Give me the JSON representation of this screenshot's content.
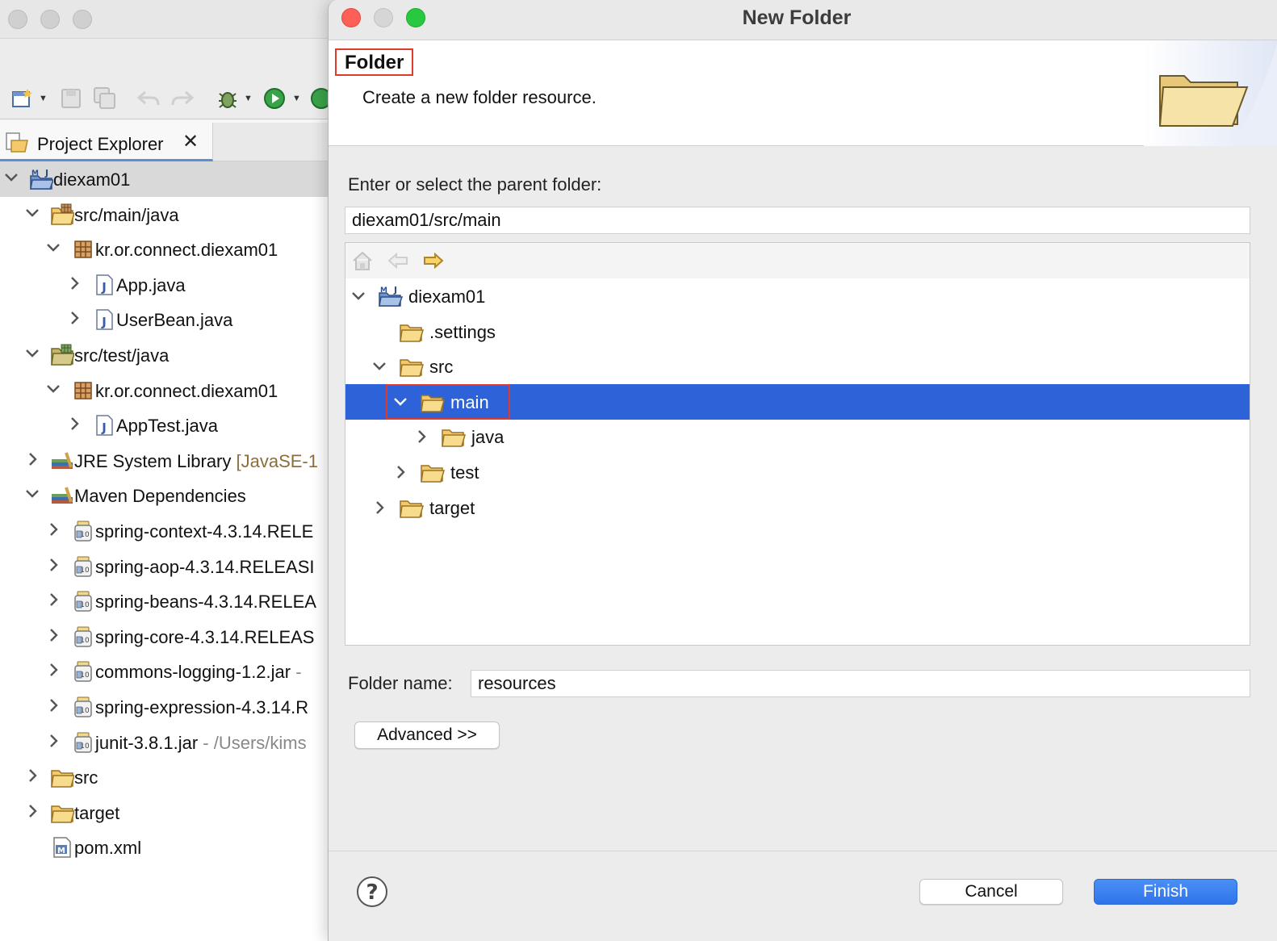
{
  "explorer": {
    "tab_label": "Project Explorer",
    "items": [
      {
        "label": "diexam01",
        "suffix": "",
        "icon": "maven-project-icon",
        "depth": 0,
        "chevron": "down"
      },
      {
        "label": "src/main/java",
        "suffix": "",
        "icon": "source-folder-icon",
        "depth": 1,
        "chevron": "down"
      },
      {
        "label": "kr.or.connect.diexam01",
        "suffix": "",
        "icon": "package-icon",
        "depth": 2,
        "chevron": "down"
      },
      {
        "label": "App.java",
        "suffix": "",
        "icon": "java-file-icon",
        "depth": 3,
        "chevron": "right"
      },
      {
        "label": "UserBean.java",
        "suffix": "",
        "icon": "java-file-icon",
        "depth": 3,
        "chevron": "right"
      },
      {
        "label": "src/test/java",
        "suffix": "",
        "icon": "test-source-folder-icon",
        "depth": 1,
        "chevron": "down"
      },
      {
        "label": "kr.or.connect.diexam01",
        "suffix": "",
        "icon": "package-icon",
        "depth": 2,
        "chevron": "down"
      },
      {
        "label": "AppTest.java",
        "suffix": "",
        "icon": "java-file-icon",
        "depth": 3,
        "chevron": "right"
      },
      {
        "label": "JRE System Library",
        "suffix": " [JavaSE-1",
        "icon": "library-icon",
        "depth": 1,
        "chevron": "right"
      },
      {
        "label": "Maven Dependencies",
        "suffix": "",
        "icon": "library-icon",
        "depth": 1,
        "chevron": "down"
      },
      {
        "label": "spring-context-4.3.14.RELE",
        "suffix": "",
        "icon": "jar-icon",
        "depth": 2,
        "chevron": "right"
      },
      {
        "label": "spring-aop-4.3.14.RELEASI",
        "suffix": "",
        "icon": "jar-icon",
        "depth": 2,
        "chevron": "right"
      },
      {
        "label": "spring-beans-4.3.14.RELEA",
        "suffix": "",
        "icon": "jar-icon",
        "depth": 2,
        "chevron": "right"
      },
      {
        "label": "spring-core-4.3.14.RELEAS",
        "suffix": "",
        "icon": "jar-icon",
        "depth": 2,
        "chevron": "right"
      },
      {
        "label": "commons-logging-1.2.jar",
        "suffix": " -",
        "icon": "jar-icon",
        "depth": 2,
        "chevron": "right"
      },
      {
        "label": "spring-expression-4.3.14.R",
        "suffix": "",
        "icon": "jar-icon",
        "depth": 2,
        "chevron": "right"
      },
      {
        "label": "junit-3.8.1.jar",
        "suffix": " - /Users/kims",
        "icon": "jar-icon",
        "depth": 2,
        "chevron": "right"
      },
      {
        "label": "src",
        "suffix": "",
        "icon": "folder-icon",
        "depth": 1,
        "chevron": "right"
      },
      {
        "label": "target",
        "suffix": "",
        "icon": "folder-icon",
        "depth": 1,
        "chevron": "right"
      },
      {
        "label": "pom.xml",
        "suffix": "",
        "icon": "maven-pom-icon",
        "depth": 1,
        "chevron": "none"
      }
    ]
  },
  "dialog": {
    "title": "New Folder",
    "header_title": "Folder",
    "header_description": "Create a new folder resource.",
    "parent_label": "Enter or select the parent folder:",
    "parent_value": "diexam01/src/main",
    "tree": [
      {
        "label": "diexam01",
        "icon": "maven-project-icon",
        "depth": 0,
        "chevron": "down",
        "selected": false
      },
      {
        "label": ".settings",
        "icon": "folder-icon",
        "depth": 1,
        "chevron": "none",
        "selected": false
      },
      {
        "label": "src",
        "icon": "folder-icon",
        "depth": 1,
        "chevron": "down",
        "selected": false
      },
      {
        "label": "main",
        "icon": "folder-icon",
        "depth": 2,
        "chevron": "down",
        "selected": true
      },
      {
        "label": "java",
        "icon": "folder-icon",
        "depth": 3,
        "chevron": "right",
        "selected": false
      },
      {
        "label": "test",
        "icon": "folder-icon",
        "depth": 2,
        "chevron": "right",
        "selected": false
      },
      {
        "label": "target",
        "icon": "folder-icon",
        "depth": 1,
        "chevron": "right",
        "selected": false
      }
    ],
    "folder_name_label": "Folder name:",
    "folder_name_value": "resources",
    "advanced_label": "Advanced >>",
    "cancel_label": "Cancel",
    "finish_label": "Finish"
  },
  "colors": {
    "selection": "#2d62d8",
    "highlight_box": "#e03a2c",
    "primary_button": "#2f74ea",
    "folder": "#f3c96b"
  }
}
